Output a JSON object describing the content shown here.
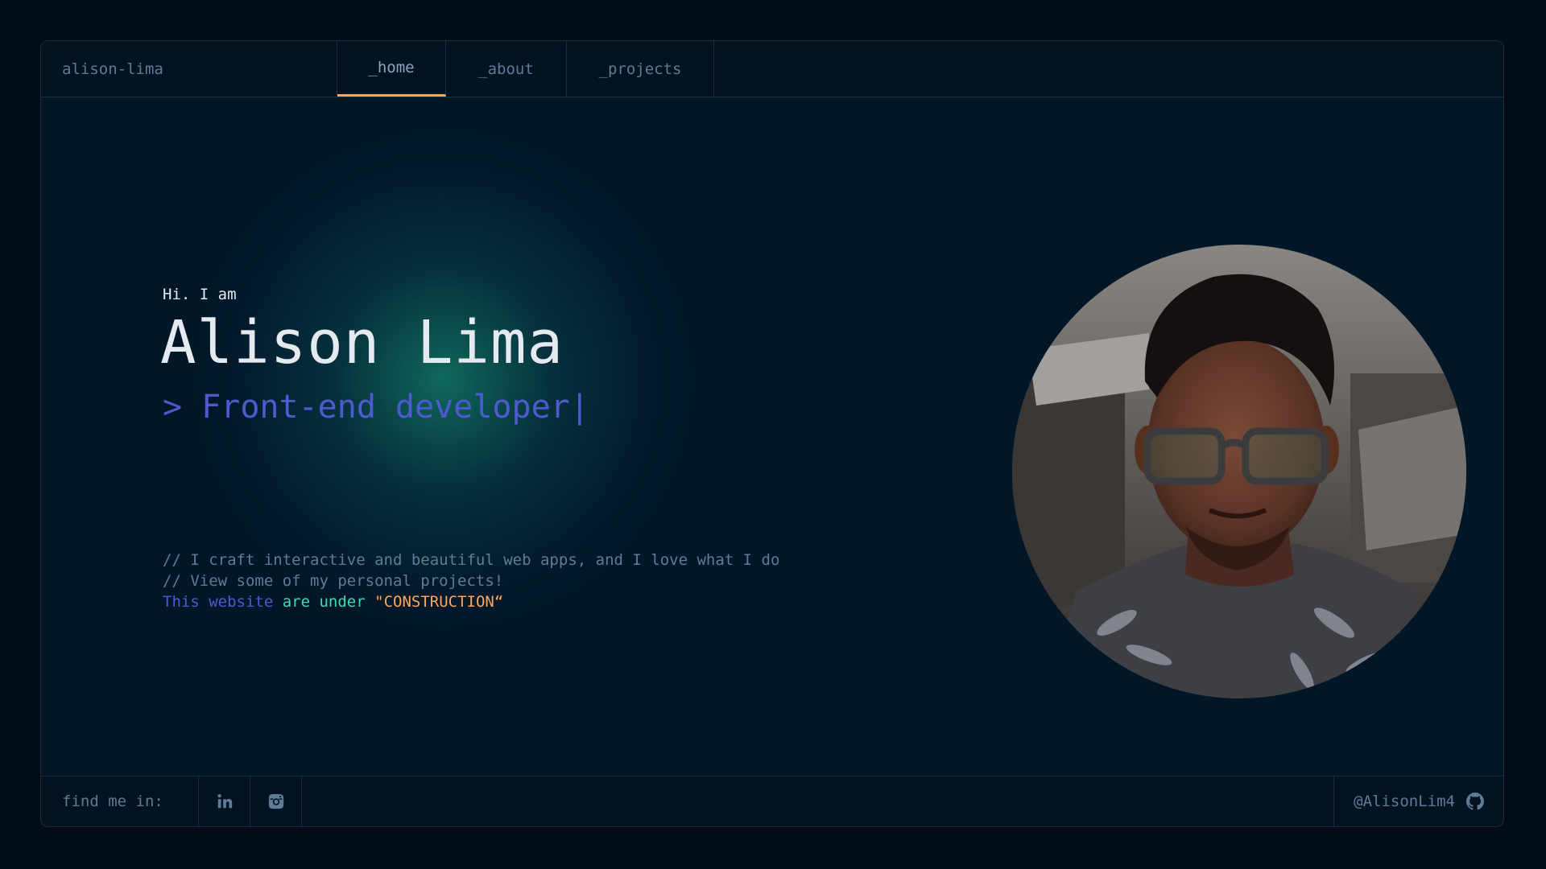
{
  "header": {
    "brand": "alison-lima",
    "tabs": [
      {
        "label": "_home",
        "active": true
      },
      {
        "label": "_about",
        "active": false
      },
      {
        "label": "_projects",
        "active": false
      }
    ]
  },
  "hero": {
    "greeting": "Hi. I am",
    "name": "Alison Lima",
    "role_prefix": ">",
    "role": "Front-end developer",
    "cursor": "|",
    "comment_1": "// I craft interactive and beautiful web apps, and I love what I do",
    "comment_2": "// View some of my personal projects!",
    "status_word_1": "This website",
    "status_word_2": "are under",
    "status_word_3": "\"CONSTRUCTION“"
  },
  "footer": {
    "find_label": "find me in:",
    "social_icons": [
      "linkedin-icon",
      "instagram-icon"
    ],
    "github_handle": "@AlisonLim4",
    "github_icon": "github-icon"
  },
  "colors": {
    "background": "#011627",
    "accent_orange": "#fea55f",
    "accent_blue": "#4d5bce",
    "accent_green": "#43d9ad",
    "text_muted": "#607b96"
  }
}
